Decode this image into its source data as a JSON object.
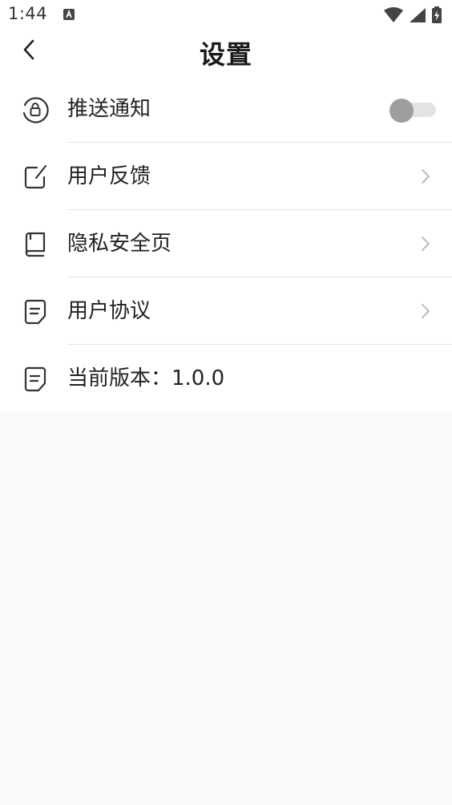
{
  "status_bar": {
    "time": "1:44",
    "notification_icon": "font-a-icon",
    "icons": [
      "wifi-icon",
      "signal-icon",
      "battery-charging-icon"
    ]
  },
  "nav": {
    "title": "设置",
    "back_icon": "chevron-left-icon"
  },
  "settings": {
    "items": [
      {
        "label": "推送通知",
        "icon": "lock-circle-icon",
        "control": "toggle",
        "toggle_on": false
      },
      {
        "label": "用户反馈",
        "icon": "edit-square-icon",
        "control": "chevron"
      },
      {
        "label": "隐私安全页",
        "icon": "book-icon",
        "control": "chevron"
      },
      {
        "label": "用户协议",
        "icon": "document-icon",
        "control": "chevron"
      },
      {
        "label": "当前版本：1.0.0",
        "icon": "document-icon",
        "control": "none"
      }
    ]
  },
  "colors": {
    "page_background": "#f8f9fb",
    "card_background": "#ffffff",
    "text": "#222222",
    "icon": "#333333",
    "chevron": "#bdbdbd",
    "divider": "#e6e6e6",
    "toggle_thumb": "#9e9e9e",
    "toggle_track": "#e3e3e3"
  }
}
